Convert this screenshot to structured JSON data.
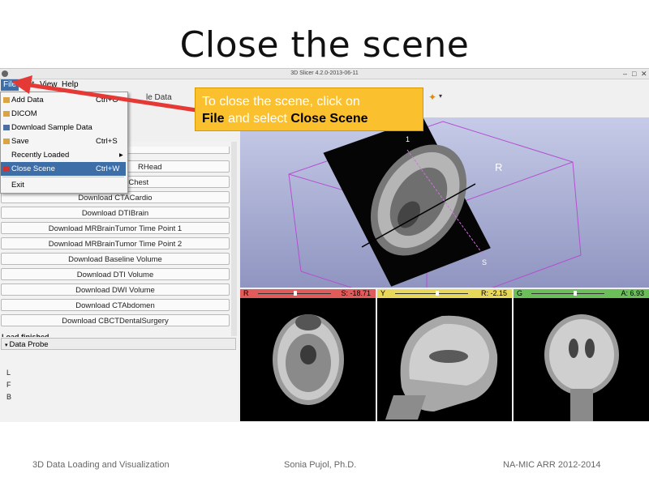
{
  "slide": {
    "title": "Close the scene",
    "footer_left": "3D Data Loading and Visualization",
    "footer_center": "Sonia Pujol, Ph.D.",
    "footer_right": "NA-MIC ARR 2012-2014"
  },
  "window": {
    "title": "3D Slicer 4.2.0-2013-06-11",
    "controls": [
      "–",
      "□",
      "✕"
    ]
  },
  "menubar": {
    "items": [
      "File",
      "Edit",
      "View",
      "Help"
    ]
  },
  "file_menu": {
    "items": [
      {
        "label": "Add Data",
        "shortcut": "Ctrl+O"
      },
      {
        "label": "DICOM",
        "shortcut": ""
      },
      {
        "label": "Download Sample Data",
        "shortcut": ""
      },
      {
        "label": "Save",
        "shortcut": "Ctrl+S"
      },
      {
        "label": "Recently Loaded",
        "shortcut": "▸"
      },
      {
        "label": "Close Scene",
        "shortcut": "Ctrl+W"
      },
      {
        "label": "Exit",
        "shortcut": ""
      }
    ],
    "highlighted": "Close Scene"
  },
  "toolbar": {
    "partial_label": "le Data"
  },
  "callout": {
    "line1": "To close the scene, click on",
    "bold1": "File",
    "mid": " and select ",
    "bold2": "Close Scene"
  },
  "sample_data": {
    "buttons": [
      "RHead",
      "Download CTChest",
      "Download CTACardio",
      "Download DTIBrain",
      "Download MRBrainTumor Time Point 1",
      "Download MRBrainTumor Time Point 2",
      "Download Baseline Volume",
      "Download DTI Volume",
      "Download DWI Volume",
      "Download CTAbdomen",
      "Download CBCTDentalSurgery"
    ],
    "status": "Load finished"
  },
  "data_probe": {
    "label": "Data Probe",
    "rows": [
      "L",
      "F",
      "B"
    ]
  },
  "view3d": {
    "labels": [
      "R",
      "1",
      "S"
    ]
  },
  "slices": [
    {
      "letter": "R",
      "value": "S: -18.71",
      "color": "#e25b5b"
    },
    {
      "letter": "Y",
      "value": "R: -2.15",
      "color": "#e8d85a"
    },
    {
      "letter": "G",
      "value": "A: 6.93",
      "color": "#6bbf59"
    }
  ],
  "colors": {
    "highlight": "#3d6ea8",
    "callout": "#fbc02d",
    "arrow": "#e53935"
  }
}
